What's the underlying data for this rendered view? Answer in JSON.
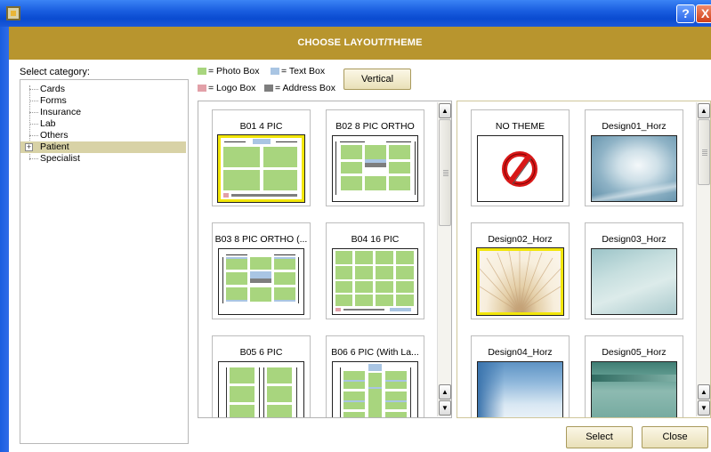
{
  "window": {
    "help_glyph": "?",
    "close_glyph": "X",
    "colors": {
      "title_bar": "#0a4bd0",
      "banner": "#b8952e",
      "selection_highlight": "#f2e60a",
      "tree_selection": "#d8d2a6"
    }
  },
  "banner": {
    "title": "CHOOSE LAYOUT/THEME"
  },
  "category": {
    "label": "Select category:",
    "items": [
      {
        "label": "Cards",
        "selected": false,
        "expandable": false
      },
      {
        "label": "Forms",
        "selected": false,
        "expandable": false
      },
      {
        "label": "Insurance",
        "selected": false,
        "expandable": false
      },
      {
        "label": "Lab",
        "selected": false,
        "expandable": false
      },
      {
        "label": "Others",
        "selected": false,
        "expandable": false
      },
      {
        "label": "Patient",
        "selected": true,
        "expandable": true,
        "expander_glyph": "+"
      },
      {
        "label": "Specialist",
        "selected": false,
        "expandable": false
      }
    ]
  },
  "legend": {
    "photo_box": "= Photo Box",
    "text_box": "= Text Box",
    "logo_box": "= Logo Box",
    "address_box": "= Address Box",
    "colors": {
      "photo": "#a8d57e",
      "text": "#a9c5e3",
      "logo": "#e2a0a8",
      "address": "#7e7e7e"
    }
  },
  "orientation_button": {
    "label": "Vertical"
  },
  "layouts": [
    {
      "label": "B01 4 PIC",
      "selected": true
    },
    {
      "label": "B02 8 PIC ORTHO",
      "selected": false
    },
    {
      "label": "B03 8 PIC ORTHO (...",
      "selected": false
    },
    {
      "label": "B04 16 PIC",
      "selected": false
    },
    {
      "label": "B05 6 PIC",
      "selected": false
    },
    {
      "label": "B06 6 PIC (With La...",
      "selected": false
    }
  ],
  "themes": [
    {
      "label": "NO THEME",
      "selected": false,
      "icon": "no-symbol-icon"
    },
    {
      "label": "Design01_Horz",
      "selected": false
    },
    {
      "label": "Design02_Horz",
      "selected": true
    },
    {
      "label": "Design03_Horz",
      "selected": false
    },
    {
      "label": "Design04_Horz",
      "selected": false
    },
    {
      "label": "Design05_Horz",
      "selected": false
    }
  ],
  "scrollbar": {
    "up_glyph": "▲",
    "down_glyph": "▼"
  },
  "actions": {
    "select_label": "Select",
    "close_label": "Close"
  }
}
